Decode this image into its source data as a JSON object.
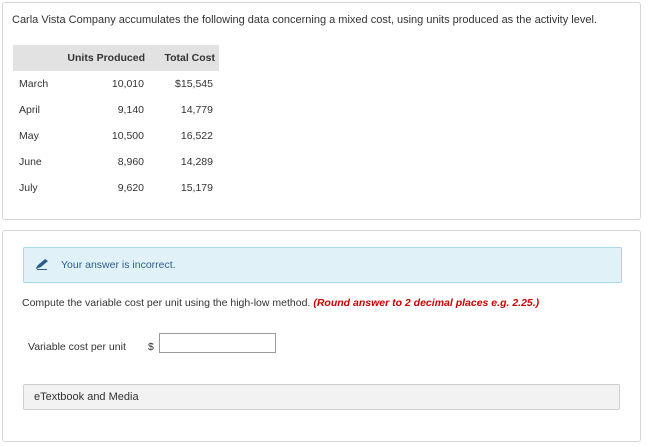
{
  "intro": "Carla Vista Company accumulates the following data concerning a mixed cost, using units produced as the activity level.",
  "table": {
    "headers": {
      "units": "Units Produced",
      "cost": "Total Cost"
    },
    "rows": [
      {
        "month": "March",
        "units": "10,010",
        "cost": "$15,545"
      },
      {
        "month": "April",
        "units": "9,140",
        "cost": "14,779"
      },
      {
        "month": "May",
        "units": "10,500",
        "cost": "16,522"
      },
      {
        "month": "June",
        "units": "8,960",
        "cost": "14,289"
      },
      {
        "month": "July",
        "units": "9,620",
        "cost": "15,179"
      }
    ]
  },
  "feedback": {
    "icon": "pencil-icon",
    "message": "Your answer is incorrect."
  },
  "question": {
    "text": "Compute the variable cost per unit using the high-low method.",
    "hint": "(Round answer to 2 decimal places e.g. 2.25.)"
  },
  "answer": {
    "label": "Variable cost per unit",
    "currency": "$",
    "value": ""
  },
  "resources": {
    "button_label": "eTextbook and Media"
  },
  "colors": {
    "header_bg": "#e2e2e2",
    "feedback_bg": "#e0f2f7",
    "feedback_text": "#2b5e8c",
    "hint_red": "#cc0000"
  }
}
